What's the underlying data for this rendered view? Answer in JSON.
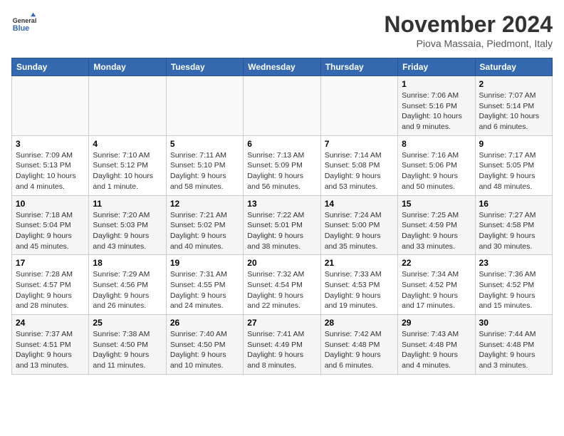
{
  "header": {
    "logo_line1": "General",
    "logo_line2": "Blue",
    "month": "November 2024",
    "location": "Piova Massaia, Piedmont, Italy"
  },
  "weekdays": [
    "Sunday",
    "Monday",
    "Tuesday",
    "Wednesday",
    "Thursday",
    "Friday",
    "Saturday"
  ],
  "weeks": [
    [
      {
        "day": "",
        "info": ""
      },
      {
        "day": "",
        "info": ""
      },
      {
        "day": "",
        "info": ""
      },
      {
        "day": "",
        "info": ""
      },
      {
        "day": "",
        "info": ""
      },
      {
        "day": "1",
        "info": "Sunrise: 7:06 AM\nSunset: 5:16 PM\nDaylight: 10 hours\nand 9 minutes."
      },
      {
        "day": "2",
        "info": "Sunrise: 7:07 AM\nSunset: 5:14 PM\nDaylight: 10 hours\nand 6 minutes."
      }
    ],
    [
      {
        "day": "3",
        "info": "Sunrise: 7:09 AM\nSunset: 5:13 PM\nDaylight: 10 hours\nand 4 minutes."
      },
      {
        "day": "4",
        "info": "Sunrise: 7:10 AM\nSunset: 5:12 PM\nDaylight: 10 hours\nand 1 minute."
      },
      {
        "day": "5",
        "info": "Sunrise: 7:11 AM\nSunset: 5:10 PM\nDaylight: 9 hours\nand 58 minutes."
      },
      {
        "day": "6",
        "info": "Sunrise: 7:13 AM\nSunset: 5:09 PM\nDaylight: 9 hours\nand 56 minutes."
      },
      {
        "day": "7",
        "info": "Sunrise: 7:14 AM\nSunset: 5:08 PM\nDaylight: 9 hours\nand 53 minutes."
      },
      {
        "day": "8",
        "info": "Sunrise: 7:16 AM\nSunset: 5:06 PM\nDaylight: 9 hours\nand 50 minutes."
      },
      {
        "day": "9",
        "info": "Sunrise: 7:17 AM\nSunset: 5:05 PM\nDaylight: 9 hours\nand 48 minutes."
      }
    ],
    [
      {
        "day": "10",
        "info": "Sunrise: 7:18 AM\nSunset: 5:04 PM\nDaylight: 9 hours\nand 45 minutes."
      },
      {
        "day": "11",
        "info": "Sunrise: 7:20 AM\nSunset: 5:03 PM\nDaylight: 9 hours\nand 43 minutes."
      },
      {
        "day": "12",
        "info": "Sunrise: 7:21 AM\nSunset: 5:02 PM\nDaylight: 9 hours\nand 40 minutes."
      },
      {
        "day": "13",
        "info": "Sunrise: 7:22 AM\nSunset: 5:01 PM\nDaylight: 9 hours\nand 38 minutes."
      },
      {
        "day": "14",
        "info": "Sunrise: 7:24 AM\nSunset: 5:00 PM\nDaylight: 9 hours\nand 35 minutes."
      },
      {
        "day": "15",
        "info": "Sunrise: 7:25 AM\nSunset: 4:59 PM\nDaylight: 9 hours\nand 33 minutes."
      },
      {
        "day": "16",
        "info": "Sunrise: 7:27 AM\nSunset: 4:58 PM\nDaylight: 9 hours\nand 30 minutes."
      }
    ],
    [
      {
        "day": "17",
        "info": "Sunrise: 7:28 AM\nSunset: 4:57 PM\nDaylight: 9 hours\nand 28 minutes."
      },
      {
        "day": "18",
        "info": "Sunrise: 7:29 AM\nSunset: 4:56 PM\nDaylight: 9 hours\nand 26 minutes."
      },
      {
        "day": "19",
        "info": "Sunrise: 7:31 AM\nSunset: 4:55 PM\nDaylight: 9 hours\nand 24 minutes."
      },
      {
        "day": "20",
        "info": "Sunrise: 7:32 AM\nSunset: 4:54 PM\nDaylight: 9 hours\nand 22 minutes."
      },
      {
        "day": "21",
        "info": "Sunrise: 7:33 AM\nSunset: 4:53 PM\nDaylight: 9 hours\nand 19 minutes."
      },
      {
        "day": "22",
        "info": "Sunrise: 7:34 AM\nSunset: 4:52 PM\nDaylight: 9 hours\nand 17 minutes."
      },
      {
        "day": "23",
        "info": "Sunrise: 7:36 AM\nSunset: 4:52 PM\nDaylight: 9 hours\nand 15 minutes."
      }
    ],
    [
      {
        "day": "24",
        "info": "Sunrise: 7:37 AM\nSunset: 4:51 PM\nDaylight: 9 hours\nand 13 minutes."
      },
      {
        "day": "25",
        "info": "Sunrise: 7:38 AM\nSunset: 4:50 PM\nDaylight: 9 hours\nand 11 minutes."
      },
      {
        "day": "26",
        "info": "Sunrise: 7:40 AM\nSunset: 4:50 PM\nDaylight: 9 hours\nand 10 minutes."
      },
      {
        "day": "27",
        "info": "Sunrise: 7:41 AM\nSunset: 4:49 PM\nDaylight: 9 hours\nand 8 minutes."
      },
      {
        "day": "28",
        "info": "Sunrise: 7:42 AM\nSunset: 4:48 PM\nDaylight: 9 hours\nand 6 minutes."
      },
      {
        "day": "29",
        "info": "Sunrise: 7:43 AM\nSunset: 4:48 PM\nDaylight: 9 hours\nand 4 minutes."
      },
      {
        "day": "30",
        "info": "Sunrise: 7:44 AM\nSunset: 4:48 PM\nDaylight: 9 hours\nand 3 minutes."
      }
    ]
  ]
}
